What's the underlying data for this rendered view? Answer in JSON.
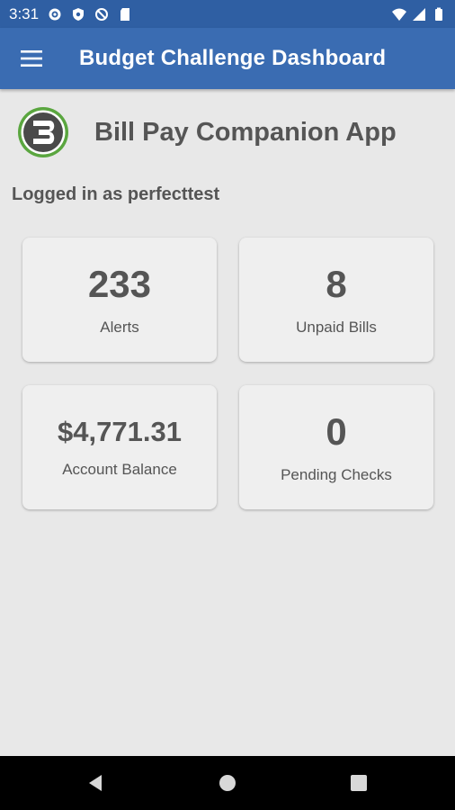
{
  "status_bar": {
    "time": "3:31",
    "icons": [
      "settings-icon",
      "shield-icon",
      "data-saver-icon",
      "sd-card-icon",
      "wifi-icon",
      "signal-icon",
      "battery-icon"
    ]
  },
  "app_bar": {
    "title": "Budget Challenge Dashboard",
    "menu_icon": "hamburger-menu-icon"
  },
  "header": {
    "title": "Bill Pay Companion App",
    "logo_icon": "budget-challenge-logo"
  },
  "user": {
    "logged_in_text": "Logged in as perfecttest"
  },
  "cards": {
    "alerts": {
      "value": "233",
      "label": "Alerts"
    },
    "unpaid_bills": {
      "value": "8",
      "label": "Unpaid Bills"
    },
    "account_balance": {
      "value": "$4,771.31",
      "label": "Account Balance"
    },
    "pending_checks": {
      "value": "0",
      "label": "Pending Checks"
    }
  },
  "nav_bar": {
    "icons": [
      "back-icon",
      "home-icon",
      "recents-icon"
    ]
  },
  "colors": {
    "status_bar": "#2f5fa3",
    "app_bar": "#3a6cb2",
    "background": "#e8e8e8",
    "card": "#efefef",
    "logo_ring": "#5aa63f"
  }
}
